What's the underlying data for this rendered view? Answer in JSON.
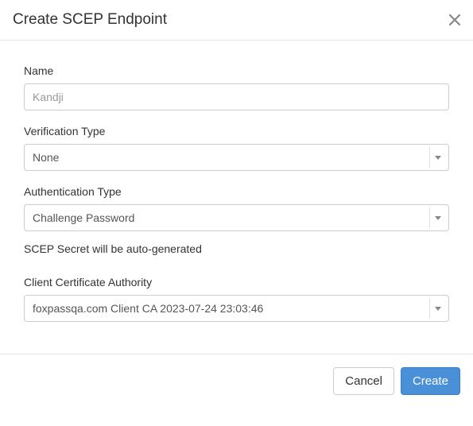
{
  "modal": {
    "title": "Create SCEP Endpoint"
  },
  "form": {
    "name": {
      "label": "Name",
      "placeholder": "Kandji",
      "value": ""
    },
    "verification_type": {
      "label": "Verification Type",
      "selected": "None"
    },
    "authentication_type": {
      "label": "Authentication Type",
      "selected": "Challenge Password",
      "help": "SCEP Secret will be auto-generated"
    },
    "client_ca": {
      "label": "Client Certificate Authority",
      "selected": "foxpassqa.com Client CA 2023-07-24 23:03:46"
    }
  },
  "footer": {
    "cancel": "Cancel",
    "create": "Create"
  }
}
